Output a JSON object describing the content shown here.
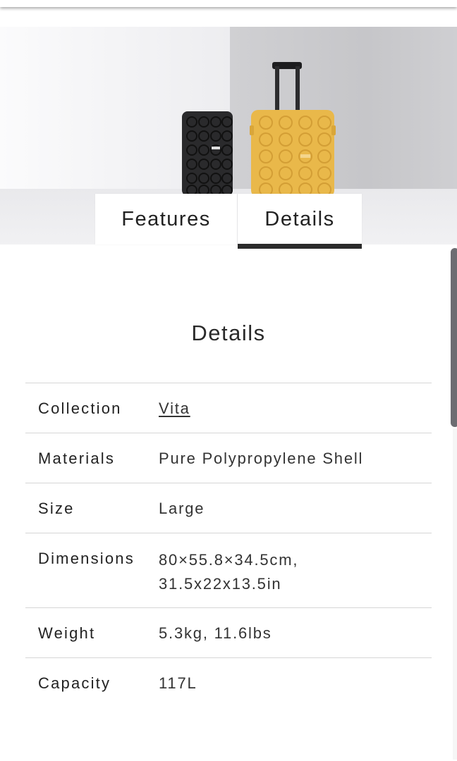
{
  "tabs": [
    {
      "label": "Features",
      "active": false
    },
    {
      "label": "Details",
      "active": true
    }
  ],
  "details": {
    "heading": "Details",
    "rows": [
      {
        "label": "Collection",
        "value": "Vita",
        "link": true
      },
      {
        "label": "Materials",
        "value": "Pure Polypropylene Shell"
      },
      {
        "label": "Size",
        "value": "Large"
      },
      {
        "label": "Dimensions",
        "value_line1": "80×55.8×34.5cm,",
        "value_line2": "31.5x22x13.5in"
      },
      {
        "label": "Weight",
        "value": "5.3kg, 11.6lbs"
      },
      {
        "label": "Capacity",
        "value": "117L"
      }
    ]
  },
  "colors": {
    "tab_underline": "#2b2b2b",
    "suitcase_yellow": "#e9b84a",
    "suitcase_black": "#2a2a2c",
    "divider": "#d6d6d6"
  }
}
